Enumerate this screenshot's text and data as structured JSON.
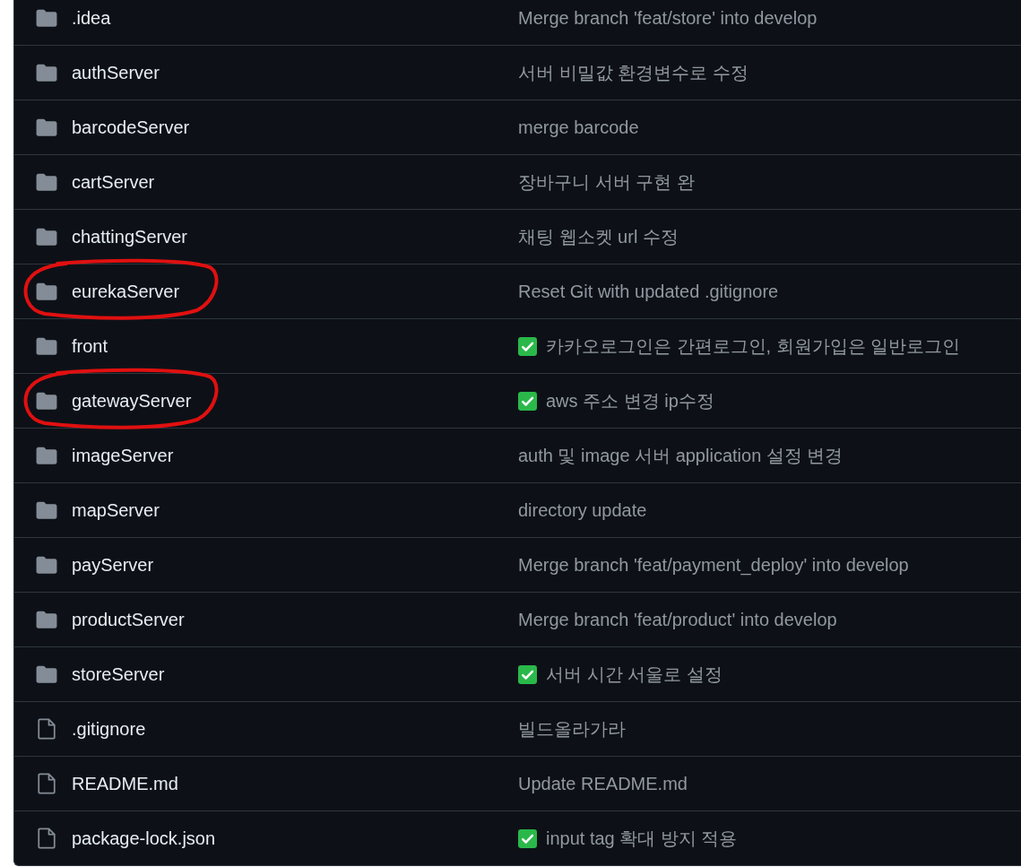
{
  "files": [
    {
      "kind": "folder",
      "name": ".idea",
      "message": "Merge branch 'feat/store' into develop",
      "check": false,
      "circled": false
    },
    {
      "kind": "folder",
      "name": "authServer",
      "message": "서버 비밀값 환경변수로 수정",
      "check": false,
      "circled": false
    },
    {
      "kind": "folder",
      "name": "barcodeServer",
      "message": "merge barcode",
      "check": false,
      "circled": false
    },
    {
      "kind": "folder",
      "name": "cartServer",
      "message": "장바구니 서버 구현 완",
      "check": false,
      "circled": false
    },
    {
      "kind": "folder",
      "name": "chattingServer",
      "message": "채팅 웹소켓 url 수정",
      "check": false,
      "circled": false
    },
    {
      "kind": "folder",
      "name": "eurekaServer",
      "message": "Reset Git with updated .gitignore",
      "check": false,
      "circled": true
    },
    {
      "kind": "folder",
      "name": "front",
      "message": "카카오로그인은 간편로그인, 회원가입은 일반로그인",
      "check": true,
      "circled": false
    },
    {
      "kind": "folder",
      "name": "gatewayServer",
      "message": "aws 주소 변경 ip수정",
      "check": true,
      "circled": true
    },
    {
      "kind": "folder",
      "name": "imageServer",
      "message": "auth 및 image 서버 application 설정 변경",
      "check": false,
      "circled": false
    },
    {
      "kind": "folder",
      "name": "mapServer",
      "message": "directory update",
      "check": false,
      "circled": false
    },
    {
      "kind": "folder",
      "name": "payServer",
      "message": "Merge branch 'feat/payment_deploy' into develop",
      "check": false,
      "circled": false
    },
    {
      "kind": "folder",
      "name": "productServer",
      "message": "Merge branch 'feat/product' into develop",
      "check": false,
      "circled": false
    },
    {
      "kind": "folder",
      "name": "storeServer",
      "message": "서버 시간 서울로 설정",
      "check": true,
      "circled": false
    },
    {
      "kind": "file",
      "name": ".gitignore",
      "message": "빌드올라가라",
      "check": false,
      "circled": false
    },
    {
      "kind": "file",
      "name": "README.md",
      "message": "Update README.md",
      "check": false,
      "circled": false
    },
    {
      "kind": "file",
      "name": "package-lock.json",
      "message": "input tag 확대 방지 적용",
      "check": true,
      "circled": false
    }
  ]
}
